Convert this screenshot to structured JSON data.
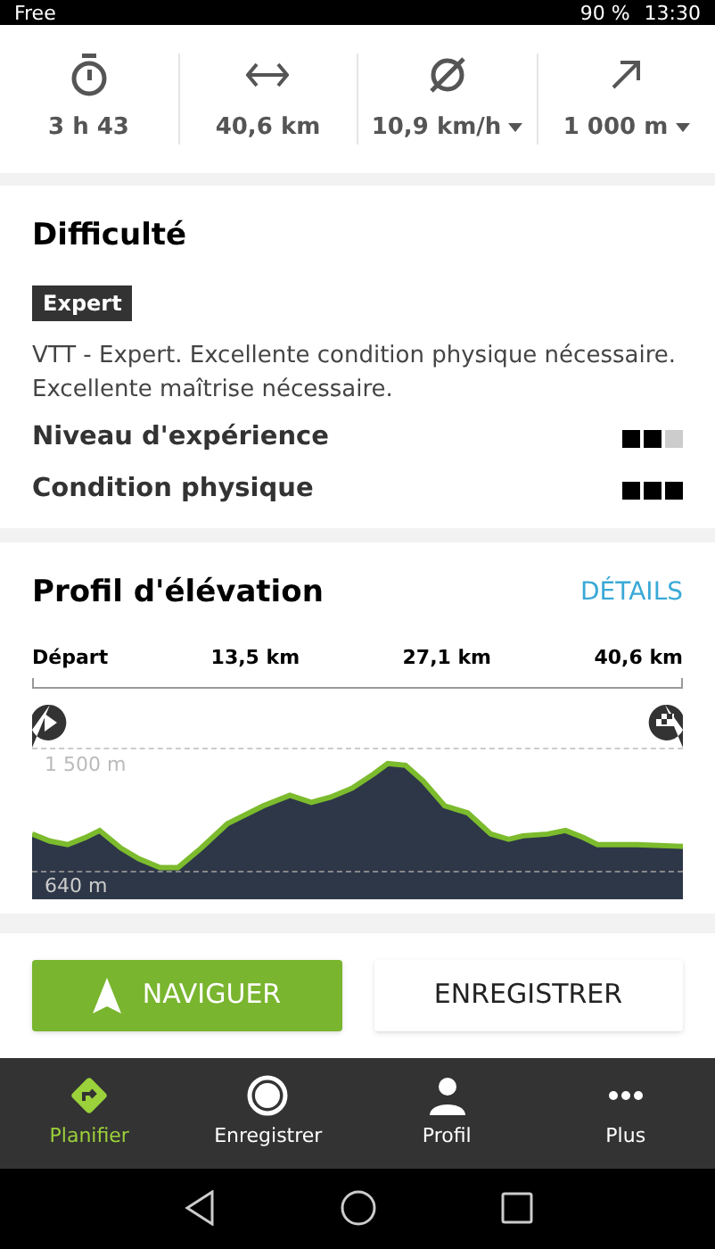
{
  "status_bar": {
    "carrier": "Free",
    "battery": "90 %",
    "time": "13:30"
  },
  "stats": [
    {
      "kind": "timer",
      "value": "3 h 43",
      "dropdown": false
    },
    {
      "kind": "distance",
      "value": "40,6 km",
      "dropdown": false
    },
    {
      "kind": "speed",
      "value": "10,9 km/h",
      "dropdown": true
    },
    {
      "kind": "climb",
      "value": "1 000 m",
      "dropdown": true
    }
  ],
  "difficulty": {
    "title": "Difficulté",
    "badge": "Expert",
    "description": "VTT - Expert. Excellente condition physique nécessaire. Excellente maîtrise nécessaire.",
    "ratings": [
      {
        "label": "Niveau d'expérience",
        "stars": 2
      },
      {
        "label": "Condition physique",
        "stars": 3
      }
    ]
  },
  "elevation": {
    "title": "Profil d'élévation",
    "link": "DÉTAILS",
    "distance_labels": [
      "Départ",
      "13,5 km",
      "27,1 km",
      "40,6 km"
    ],
    "max_label": "1 500 m",
    "min_label": "640 m"
  },
  "actions": [
    {
      "kind": "primary",
      "label": "NAVIGUER"
    },
    {
      "kind": "secondary",
      "label": "ENREGISTRER"
    }
  ],
  "tabs": [
    {
      "kind": "plan",
      "label": "Planifier",
      "selected": true
    },
    {
      "kind": "record",
      "label": "Enregistrer",
      "selected": false
    },
    {
      "kind": "profile",
      "label": "Profil",
      "selected": false
    },
    {
      "kind": "more",
      "label": "Plus",
      "selected": false
    }
  ]
}
